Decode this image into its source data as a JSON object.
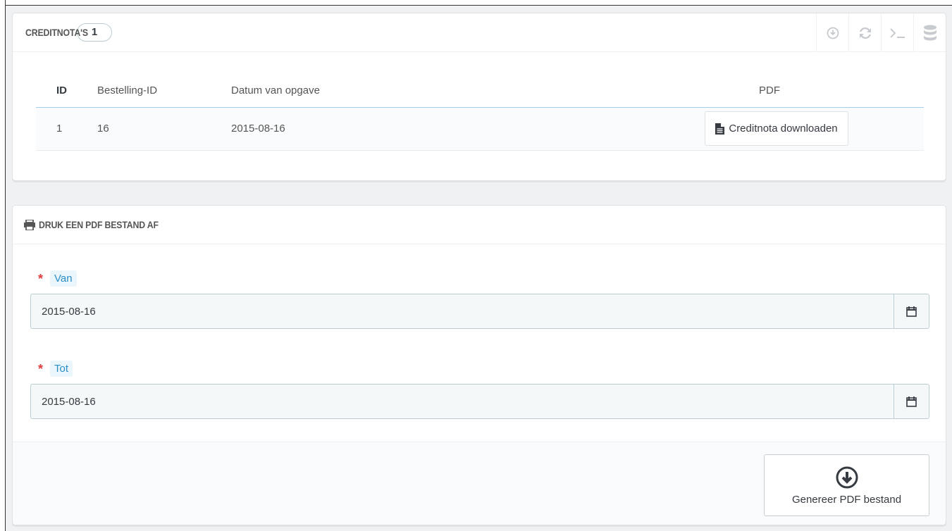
{
  "credit_panel": {
    "title": "Creditnota's",
    "count": "1",
    "toolbar": [
      {
        "icon": "download-circle-icon"
      },
      {
        "icon": "refresh-icon"
      },
      {
        "icon": "terminal-icon"
      },
      {
        "icon": "database-icon"
      }
    ],
    "table": {
      "columns": [
        "ID",
        "Bestelling-ID",
        "Datum van opgave",
        "PDF"
      ],
      "rows": [
        {
          "id": "1",
          "order_id": "16",
          "date": "2015-08-16",
          "pdf_button": "Creditnota downloaden"
        }
      ]
    }
  },
  "print_panel": {
    "title": "Druk een PDF bestand af",
    "from_label": "Van",
    "from_value": "2015-08-16",
    "to_label": "Tot",
    "to_value": "2015-08-16",
    "required_mark": "*",
    "generate_button": "Genereer PDF bestand"
  },
  "colors": {
    "accent": "#25b9d7",
    "required": "#e23b3b",
    "table_header_border": "#a0d0eb"
  }
}
